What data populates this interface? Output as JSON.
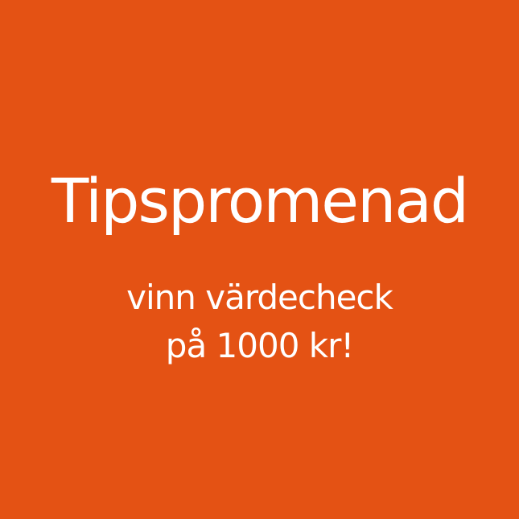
{
  "background_color": "#E45214",
  "text_color": "#FFFFFF",
  "title": "Tipspromenad",
  "subtitle": {
    "line1": "vinn värdecheck",
    "line2": "på 1000 kr!"
  }
}
